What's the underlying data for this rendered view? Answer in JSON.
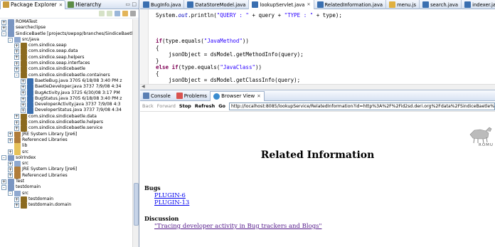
{
  "left_panel": {
    "tabs": [
      {
        "label": "Package Explorer"
      },
      {
        "label": "Hierarchy"
      }
    ],
    "tree": [
      {
        "level": 0,
        "toggle": "+",
        "icon": "project",
        "label": "ROMATest"
      },
      {
        "level": 0,
        "toggle": "+",
        "icon": "project",
        "label": "searcheclipse"
      },
      {
        "level": 0,
        "toggle": "-",
        "icon": "project",
        "label": "SindiceBaetle [projects/swpop/branches/SindiceBaetl"
      },
      {
        "level": 1,
        "toggle": "-",
        "icon": "srcfolder",
        "label": "src/java"
      },
      {
        "level": 2,
        "toggle": "+",
        "icon": "package",
        "label": "com.sindice.seap"
      },
      {
        "level": 2,
        "toggle": "+",
        "icon": "package",
        "label": "com.sindice.seap.data"
      },
      {
        "level": 2,
        "toggle": "+",
        "icon": "package",
        "label": "com.sindice.seap.helpers"
      },
      {
        "level": 2,
        "toggle": "+",
        "icon": "package",
        "label": "com.sindice.seap.interfaces"
      },
      {
        "level": 2,
        "toggle": "+",
        "icon": "package",
        "label": "com.sindice.sindicebaetle"
      },
      {
        "level": 2,
        "toggle": "-",
        "icon": "package",
        "label": "com.sindice.sindicebaetle.containers"
      },
      {
        "level": 3,
        "toggle": "+",
        "icon": "java",
        "label": "BaetleBug.java 3705  6/18/08 3:40 PM  z"
      },
      {
        "level": 3,
        "toggle": "+",
        "icon": "java",
        "label": "BaetleDeveloper.java 3737  7/9/08 4:34"
      },
      {
        "level": 3,
        "toggle": "+",
        "icon": "java",
        "label": "BugActivity.java 3725  6/30/08 3:17 PM"
      },
      {
        "level": 3,
        "toggle": "+",
        "icon": "java",
        "label": "BugStatus.java 3705  6/18/08 3:40 PM  z"
      },
      {
        "level": 3,
        "toggle": "+",
        "icon": "java",
        "label": "DeveloperActivity.java 3737  7/9/08 4:3"
      },
      {
        "level": 3,
        "toggle": "+",
        "icon": "java",
        "label": "DeveloperStatus.java 3737  7/9/08 4:34"
      },
      {
        "level": 2,
        "toggle": "+",
        "icon": "package",
        "label": "com.sindice.sindicebaetle.data"
      },
      {
        "level": 2,
        "toggle": "+",
        "icon": "package",
        "label": "com.sindice.sindicebaetle.helpers"
      },
      {
        "level": 2,
        "toggle": "+",
        "icon": "package",
        "label": "com.sindice.sindicebaetle.service"
      },
      {
        "level": 1,
        "toggle": "+",
        "icon": "library",
        "label": "JRE System Library [jre6]"
      },
      {
        "level": 1,
        "toggle": "+",
        "icon": "library",
        "label": "Referenced Libraries"
      },
      {
        "level": 1,
        "toggle": "",
        "icon": "folder",
        "label": "lib"
      },
      {
        "level": 1,
        "toggle": "+",
        "icon": "folder",
        "label": "src"
      },
      {
        "level": 0,
        "toggle": "-",
        "icon": "project",
        "label": "solrIndex"
      },
      {
        "level": 1,
        "toggle": "+",
        "icon": "srcfolder",
        "label": "src"
      },
      {
        "level": 1,
        "toggle": "+",
        "icon": "library",
        "label": "JRE System Library [jre6]"
      },
      {
        "level": 1,
        "toggle": "+",
        "icon": "library",
        "label": "Referenced Libraries"
      },
      {
        "level": 0,
        "toggle": "+",
        "icon": "project",
        "label": "Test"
      },
      {
        "level": 0,
        "toggle": "-",
        "icon": "project",
        "label": "testdomain"
      },
      {
        "level": 1,
        "toggle": "-",
        "icon": "srcfolder",
        "label": "src"
      },
      {
        "level": 2,
        "toggle": "+",
        "icon": "package",
        "label": "testdomain"
      },
      {
        "level": 2,
        "toggle": "+",
        "icon": "package",
        "label": "testdomain.domain"
      }
    ]
  },
  "editor": {
    "tabs": [
      {
        "label": "BugInfo.java",
        "active": false
      },
      {
        "label": "DataStoreModel.java",
        "active": false
      },
      {
        "label": "lookupServlet.java",
        "active": true
      },
      {
        "label": "RelatedInformation.java",
        "active": false
      },
      {
        "label": "menu.js",
        "active": false
      },
      {
        "label": "search.java",
        "active": false
      },
      {
        "label": "indexer.java",
        "active": false
      }
    ],
    "code_lines": [
      [
        {
          "t": "System.",
          "c": ""
        },
        {
          "t": "out",
          "c": "fld"
        },
        {
          "t": ".println(",
          "c": ""
        },
        {
          "t": "\"QUERY : \"",
          "c": "st"
        },
        {
          "t": " + query + ",
          "c": ""
        },
        {
          "t": "\"TYPE : \"",
          "c": "st"
        },
        {
          "t": " + type);",
          "c": ""
        }
      ],
      [],
      [],
      [],
      [
        {
          "t": "if",
          "c": "kw"
        },
        {
          "t": "(type.equals(",
          "c": ""
        },
        {
          "t": "\"JavaMethod\"",
          "c": "st"
        },
        {
          "t": "))",
          "c": ""
        }
      ],
      [
        {
          "t": "{",
          "c": ""
        }
      ],
      [
        {
          "t": "    jsonObject = dsModel.getMethodInfo(query);",
          "c": ""
        }
      ],
      [
        {
          "t": "}",
          "c": ""
        }
      ],
      [
        {
          "t": "else if",
          "c": "kw"
        },
        {
          "t": "(type.equals(",
          "c": ""
        },
        {
          "t": "\"JavaClass\"",
          "c": "st"
        },
        {
          "t": "))",
          "c": ""
        }
      ],
      [
        {
          "t": "{",
          "c": ""
        }
      ],
      [
        {
          "t": "    jsonObject = dsModel.getClassInfo(query);",
          "c": ""
        }
      ]
    ]
  },
  "bottom_panel": {
    "tabs": [
      {
        "label": "Console",
        "active": false
      },
      {
        "label": "Problems",
        "active": false
      },
      {
        "label": "Browser View",
        "active": true
      }
    ],
    "nav": {
      "back": "Back",
      "forward": "Forward",
      "stop": "Stop",
      "refresh": "Refresh",
      "go": "Go"
    },
    "url": "http://localhost:8085/lookupService/RelatedInformation?id=http%3A%2F%2Fid2sd.deri.org%2Fdata%2FSindiceBaetle%2FJavaSource%2",
    "page": {
      "title": "Related Information",
      "logo_text": "ROMU",
      "bugs_heading": "Bugs",
      "bug_links": [
        "PLUGIN-6",
        "PLUGIN-13"
      ],
      "discussion_heading": "Discussion",
      "discussion_links": [
        "\"Tracing developer activity in Bug trackers and Blogs\""
      ]
    }
  },
  "colors": {
    "keyword": "#7f0055",
    "string": "#2a00ff",
    "link": "#0000ee",
    "visited": "#551a8b",
    "package": "#8b6a1f",
    "java": "#3a6fb0",
    "project": "#7a96c2",
    "library": "#b07c3a"
  }
}
